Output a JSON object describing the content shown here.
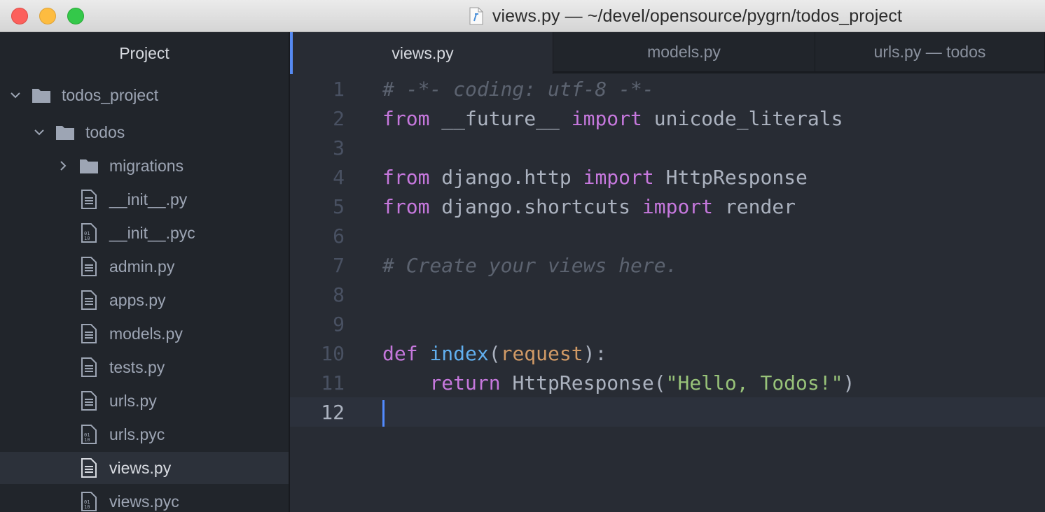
{
  "window": {
    "title": "views.py — ~/devel/opensource/pygrn/todos_project"
  },
  "sidebar": {
    "header": "Project",
    "items": [
      {
        "label": "todos_project",
        "type": "folder",
        "expanded": true,
        "depth": 0
      },
      {
        "label": "todos",
        "type": "folder",
        "expanded": true,
        "depth": 1
      },
      {
        "label": "migrations",
        "type": "folder",
        "expanded": false,
        "depth": 2
      },
      {
        "label": "__init__.py",
        "type": "file-text",
        "depth": 2
      },
      {
        "label": "__init__.pyc",
        "type": "file-binary",
        "depth": 2
      },
      {
        "label": "admin.py",
        "type": "file-text",
        "depth": 2
      },
      {
        "label": "apps.py",
        "type": "file-text",
        "depth": 2
      },
      {
        "label": "models.py",
        "type": "file-text",
        "depth": 2
      },
      {
        "label": "tests.py",
        "type": "file-text",
        "depth": 2
      },
      {
        "label": "urls.py",
        "type": "file-text",
        "depth": 2
      },
      {
        "label": "urls.pyc",
        "type": "file-binary",
        "depth": 2
      },
      {
        "label": "views.py",
        "type": "file-text",
        "depth": 2,
        "selected": true
      },
      {
        "label": "views.pyc",
        "type": "file-binary",
        "depth": 2
      }
    ]
  },
  "tabs": [
    {
      "label": "views.py",
      "active": true
    },
    {
      "label": "models.py",
      "active": false
    },
    {
      "label": "urls.py — todos",
      "active": false
    }
  ],
  "editor": {
    "line_numbers": [
      "1",
      "2",
      "3",
      "4",
      "5",
      "6",
      "7",
      "8",
      "9",
      "10",
      "11",
      "12"
    ],
    "active_line": "12",
    "lines": [
      [
        {
          "t": "# -*- coding: utf-8 -*-",
          "c": "cm"
        }
      ],
      [
        {
          "t": "from",
          "c": "kw"
        },
        {
          "t": " __future__ "
        },
        {
          "t": "import",
          "c": "kw"
        },
        {
          "t": " unicode_literals"
        }
      ],
      [],
      [
        {
          "t": "from",
          "c": "kw"
        },
        {
          "t": " django.http "
        },
        {
          "t": "import",
          "c": "kw"
        },
        {
          "t": " HttpResponse"
        }
      ],
      [
        {
          "t": "from",
          "c": "kw"
        },
        {
          "t": " django.shortcuts "
        },
        {
          "t": "import",
          "c": "kw"
        },
        {
          "t": " render"
        }
      ],
      [],
      [
        {
          "t": "# Create your views here.",
          "c": "cm"
        }
      ],
      [],
      [],
      [
        {
          "t": "def",
          "c": "kw"
        },
        {
          "t": " "
        },
        {
          "t": "index",
          "c": "fn"
        },
        {
          "t": "("
        },
        {
          "t": "request",
          "c": "pa"
        },
        {
          "t": "):"
        }
      ],
      [
        {
          "t": "    "
        },
        {
          "t": "return",
          "c": "kw"
        },
        {
          "t": " HttpResponse("
        },
        {
          "t": "\"Hello, Todos!\"",
          "c": "st"
        },
        {
          "t": ")"
        }
      ],
      []
    ]
  },
  "colors": {
    "accent": "#568af2",
    "keyword": "#c678dd",
    "comment": "#5c6370",
    "function": "#61afef",
    "param": "#d19a66",
    "string": "#98c379"
  }
}
